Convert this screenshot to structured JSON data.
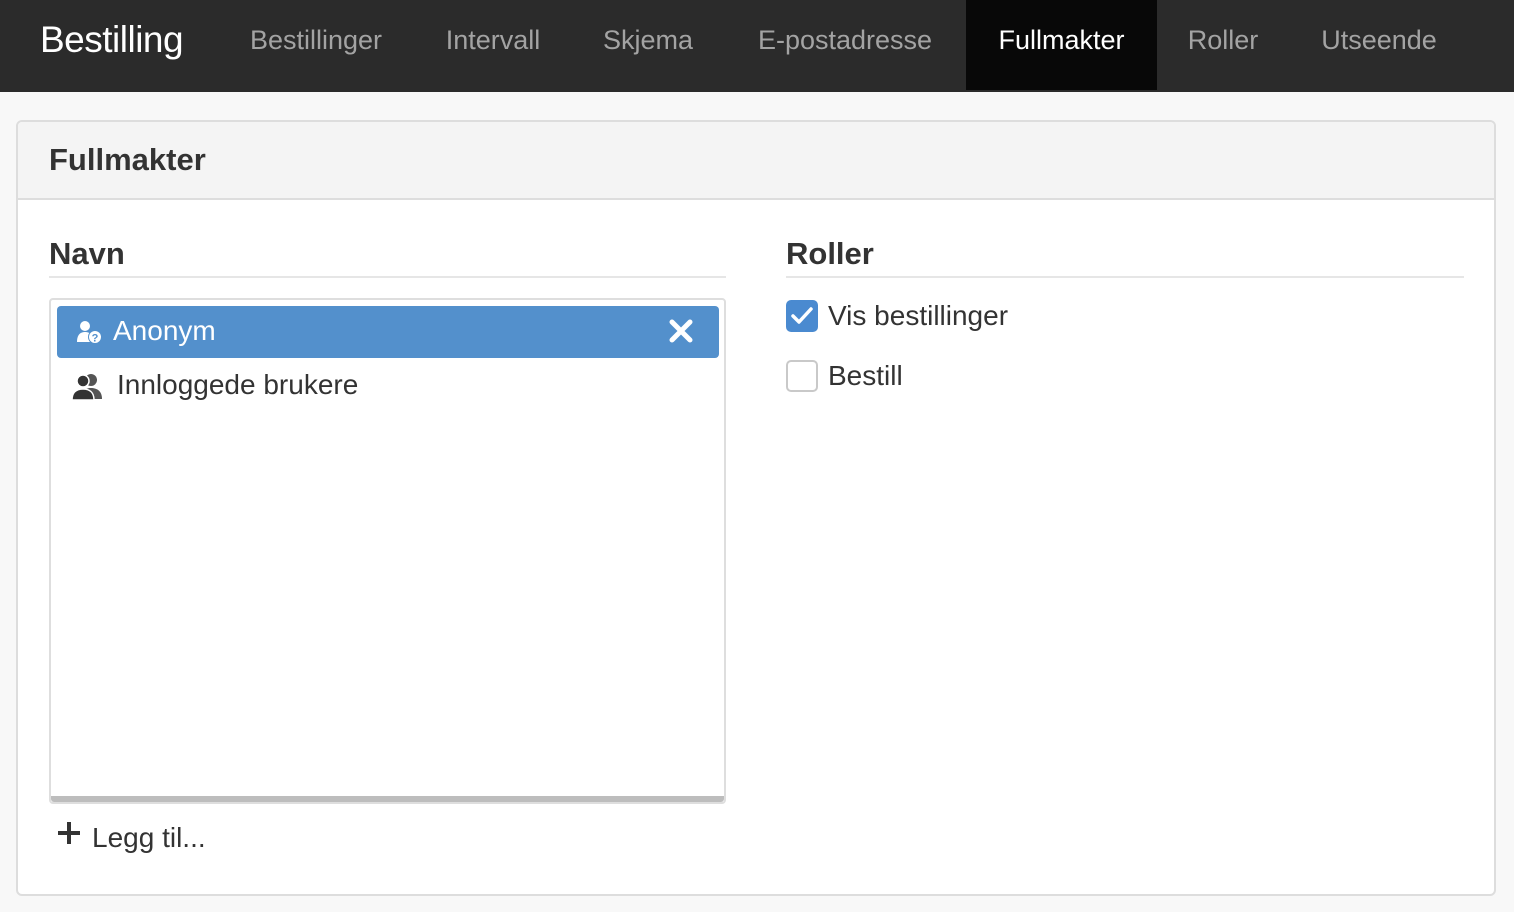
{
  "navbar": {
    "brand": "Bestilling",
    "tabs": [
      {
        "label": "Bestillinger",
        "active": false
      },
      {
        "label": "Intervall",
        "active": false
      },
      {
        "label": "Skjema",
        "active": false
      },
      {
        "label": "E-postadresse",
        "active": false
      },
      {
        "label": "Fullmakter",
        "active": true
      },
      {
        "label": "Roller",
        "active": false
      },
      {
        "label": "Utseende",
        "active": false
      }
    ]
  },
  "panel": {
    "title": "Fullmakter",
    "names": {
      "heading": "Navn",
      "items": [
        {
          "label": "Anonym",
          "icon": "anonymous-user-icon",
          "selected": true
        },
        {
          "label": "Innloggede brukere",
          "icon": "users-icon",
          "selected": false
        }
      ],
      "add_label": "Legg til..."
    },
    "roles": {
      "heading": "Roller",
      "options": [
        {
          "label": "Vis bestillinger",
          "checked": true
        },
        {
          "label": "Bestill",
          "checked": false
        }
      ]
    }
  },
  "colors": {
    "navbar_bg": "#2b2b2b",
    "active_tab_bg": "#080808",
    "selected_item": "#5390cc",
    "checkbox_checked": "#4a8ad0"
  }
}
